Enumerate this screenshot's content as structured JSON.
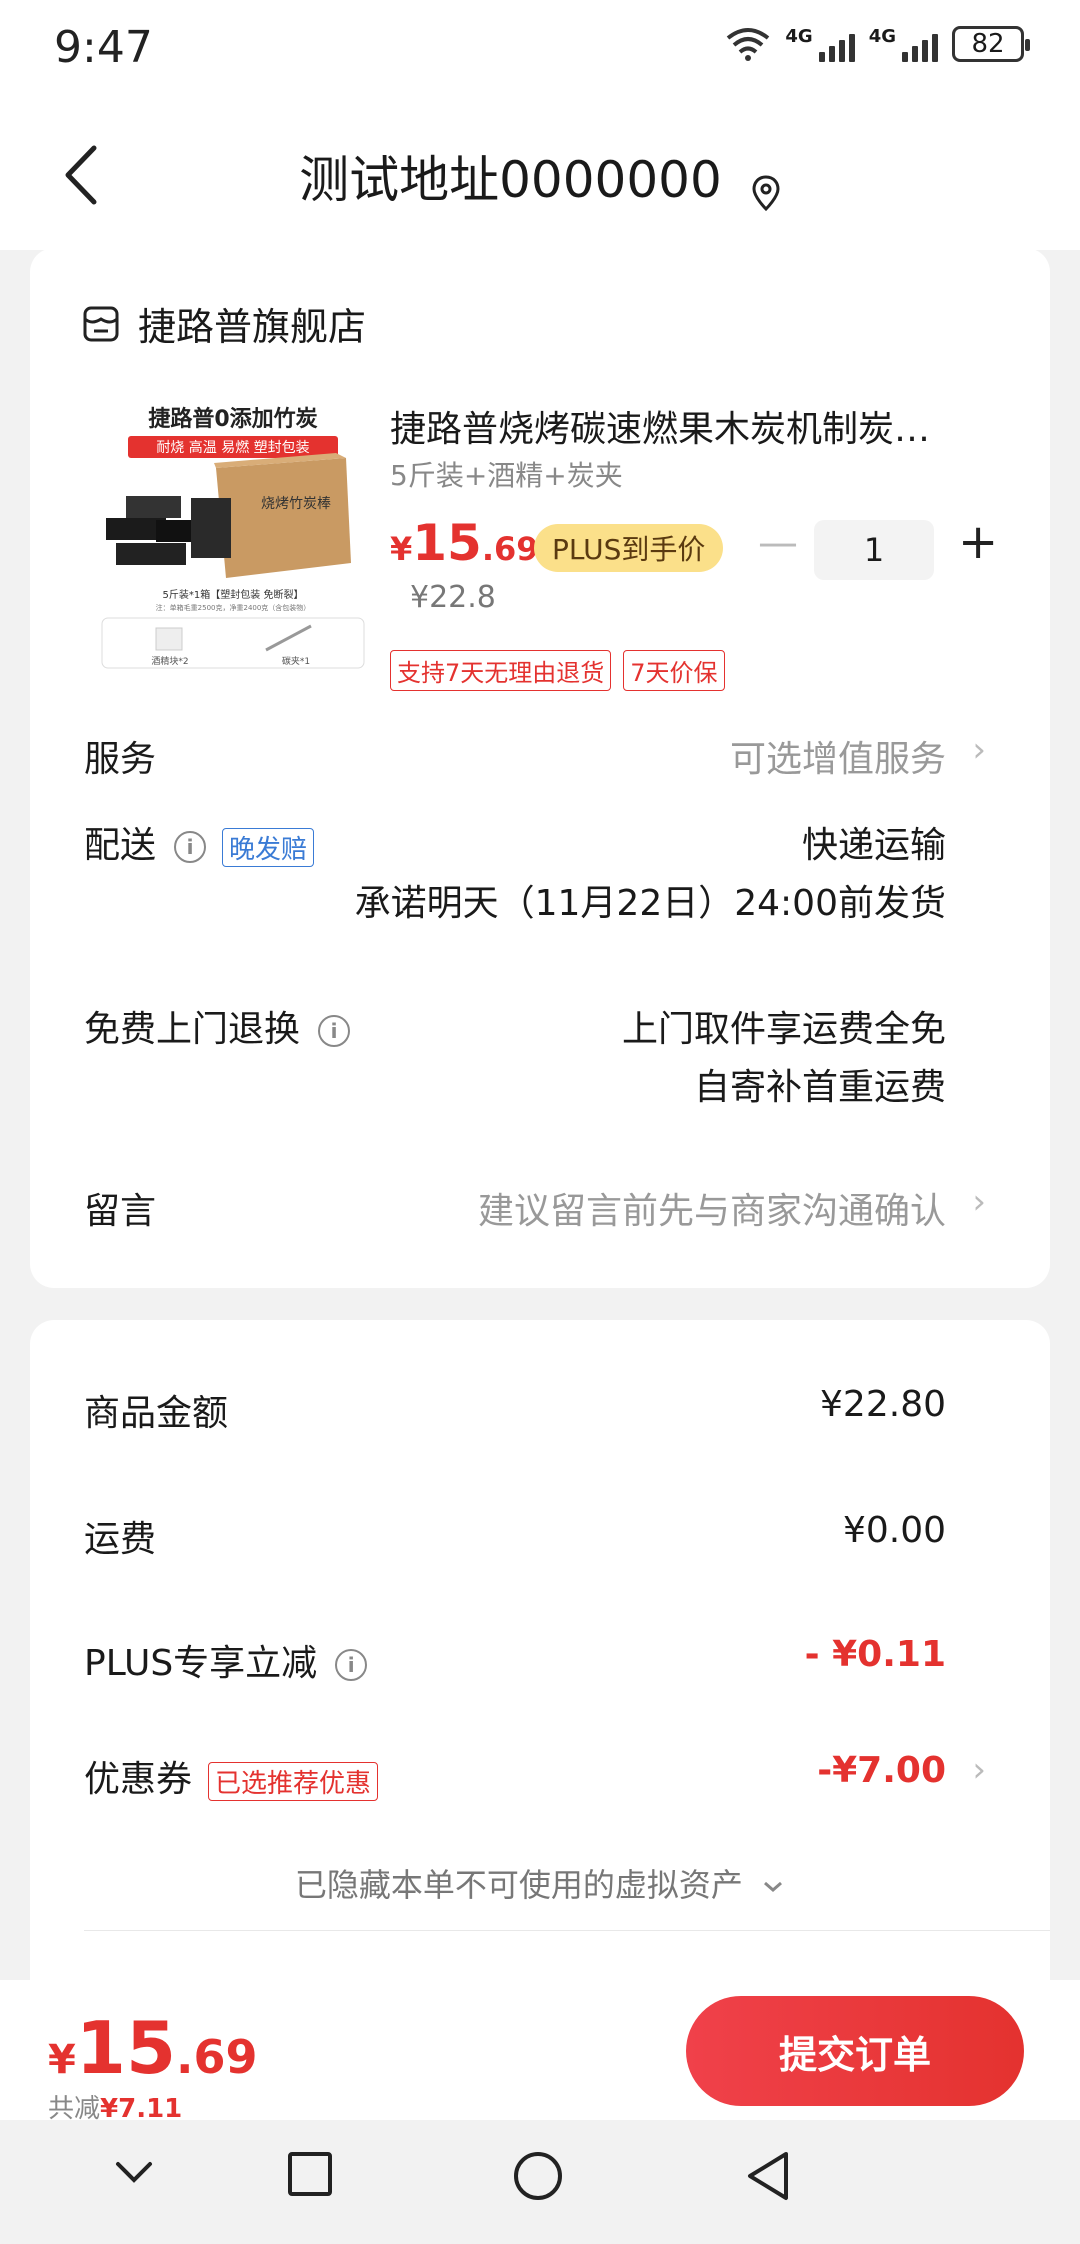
{
  "status": {
    "time": "9:47",
    "battery": "82",
    "net1": "4G",
    "net2": "4G"
  },
  "nav": {
    "title": "测试地址0000000"
  },
  "store": {
    "name": "捷路普旗舰店"
  },
  "product": {
    "title": "捷路普烧烤碳速燃果木炭机制炭…",
    "spec": "5斤装+酒精+炭夹",
    "price_yen": "¥",
    "price_int": "15",
    "price_dec": ".69",
    "plus_label": "PLUS到手价",
    "orig_price": "¥22.8",
    "qty": "1",
    "tags": [
      "支持7天无理由退货",
      "7天价保"
    ],
    "image_text": {
      "headline": "捷路普0添加竹炭",
      "sub": "耐烧 高温 易燃 塑封包装",
      "box": "烧烤竹炭棒",
      "caption": "5斤装*1箱【塑封包装 免断裂】",
      "note": "注：单箱毛重2500克，净重2400克（含包装物）",
      "gift1": "酒精块*2",
      "gift2": "碳夹*1"
    }
  },
  "rows": {
    "service_label": "服务",
    "service_value": "可选增值服务",
    "delivery_label": "配送",
    "delivery_tag": "晚发赔",
    "delivery_value1": "快递运输",
    "delivery_value2": "承诺明天（11月22日）24:00前发货",
    "return_label": "免费上门退换",
    "return_value1": "上门取件享运费全免",
    "return_value2": "自寄补首重运费",
    "message_label": "留言",
    "message_placeholder": "建议留言前先与商家沟通确认"
  },
  "summary": {
    "goods_label": "商品金额",
    "goods_value": "¥22.80",
    "shipping_label": "运费",
    "shipping_value": "¥0.00",
    "plus_label": "PLUS专享立减",
    "plus_value": "- ¥0.11",
    "coupon_label": "优惠券",
    "coupon_tag": "已选推荐优惠",
    "coupon_value": "-¥7.00",
    "hidden_assets": "已隐藏本单不可使用的虚拟资产"
  },
  "bottom": {
    "yen": "¥",
    "int": "15",
    "dec": ".69",
    "saved_label": "共减",
    "saved_value": "¥7.11",
    "submit_label": "提交订单"
  },
  "colors": {
    "accent": "#e4322f",
    "plus_badge": "#fbe08a",
    "blue_tag": "#3a7bd5"
  },
  "icons": [
    "back-chevron-icon",
    "location-pin-icon",
    "store-icon",
    "info-icon",
    "chevron-right-icon",
    "chevron-down-icon",
    "wifi-icon",
    "signal-icon",
    "battery-icon",
    "nav-down-icon",
    "nav-square-icon",
    "nav-circle-icon",
    "nav-back-triangle-icon"
  ]
}
